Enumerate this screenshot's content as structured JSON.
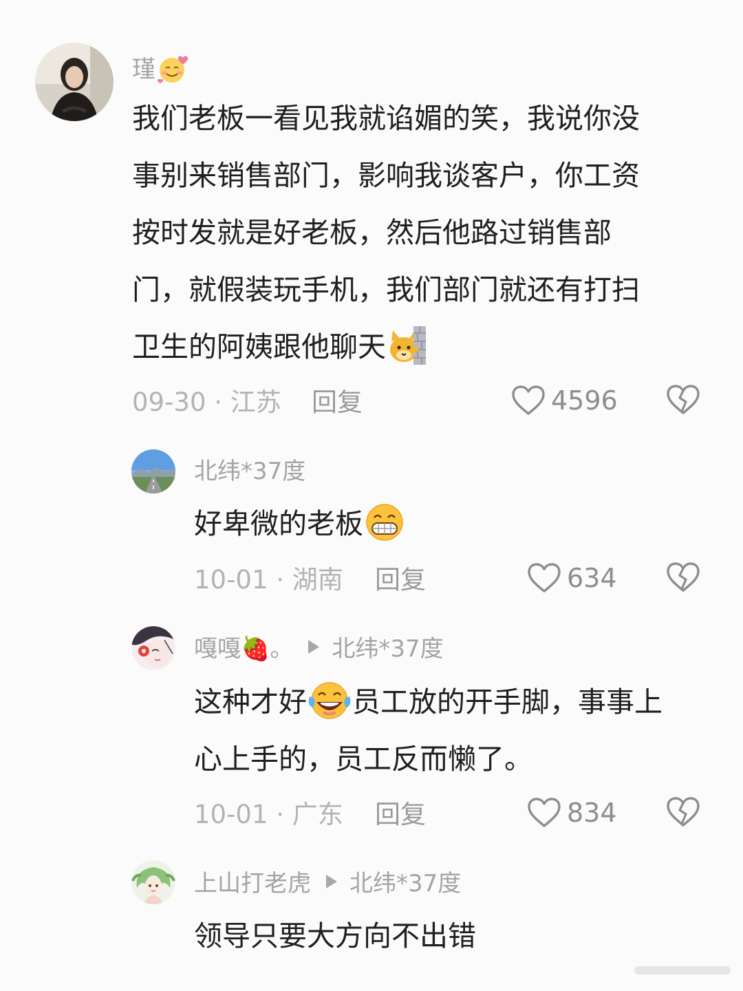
{
  "comments": [
    {
      "user": "瑾",
      "text_lines": [
        "我们老板一看见我就谄媚的笑，我说你没",
        "事别来销售部门，影响我谈客户，你工资",
        "按时发就是好老板，然后他路过销售部",
        "门，就假装玩手机，我们部门就还有打扫",
        "卫生的阿姨跟他聊天"
      ],
      "date_location": "09-30 · 江苏",
      "reply_label": "回复",
      "likes": "4596",
      "emoji_icons": [
        "smiling-face-with-hearts-icon",
        "cat-peeking-behind-wall-icon"
      ]
    },
    {
      "user": "北纬*37度",
      "text_lines": [
        "好卑微的老板"
      ],
      "date_location": "10-01 · 湖南",
      "reply_label": "回复",
      "likes": "634",
      "emoji_icons": [
        "grinning-face-icon"
      ]
    },
    {
      "user": "嘎嘎🍓。",
      "reply_to": "北纬*37度",
      "text_lines_a": [
        "这种才好",
        "员工放的开手脚，事事上"
      ],
      "text_lines": [
        "心上手的，员工反而懒了。"
      ],
      "date_location": "10-01 · 广东",
      "reply_label": "回复",
      "likes": "834",
      "emoji_icons": [
        "crying-laughing-face-icon"
      ]
    },
    {
      "user": "上山打老虎",
      "reply_to": "北纬*37度",
      "text_lines": [
        "领导只要大方向不出错"
      ]
    }
  ],
  "colors": {
    "background": "#fbfbfb",
    "username": "#a4a4a4",
    "body_text": "#1f1f1f",
    "meta_text": "#b3b3b3",
    "icon_gray": "#8d8d8d"
  }
}
